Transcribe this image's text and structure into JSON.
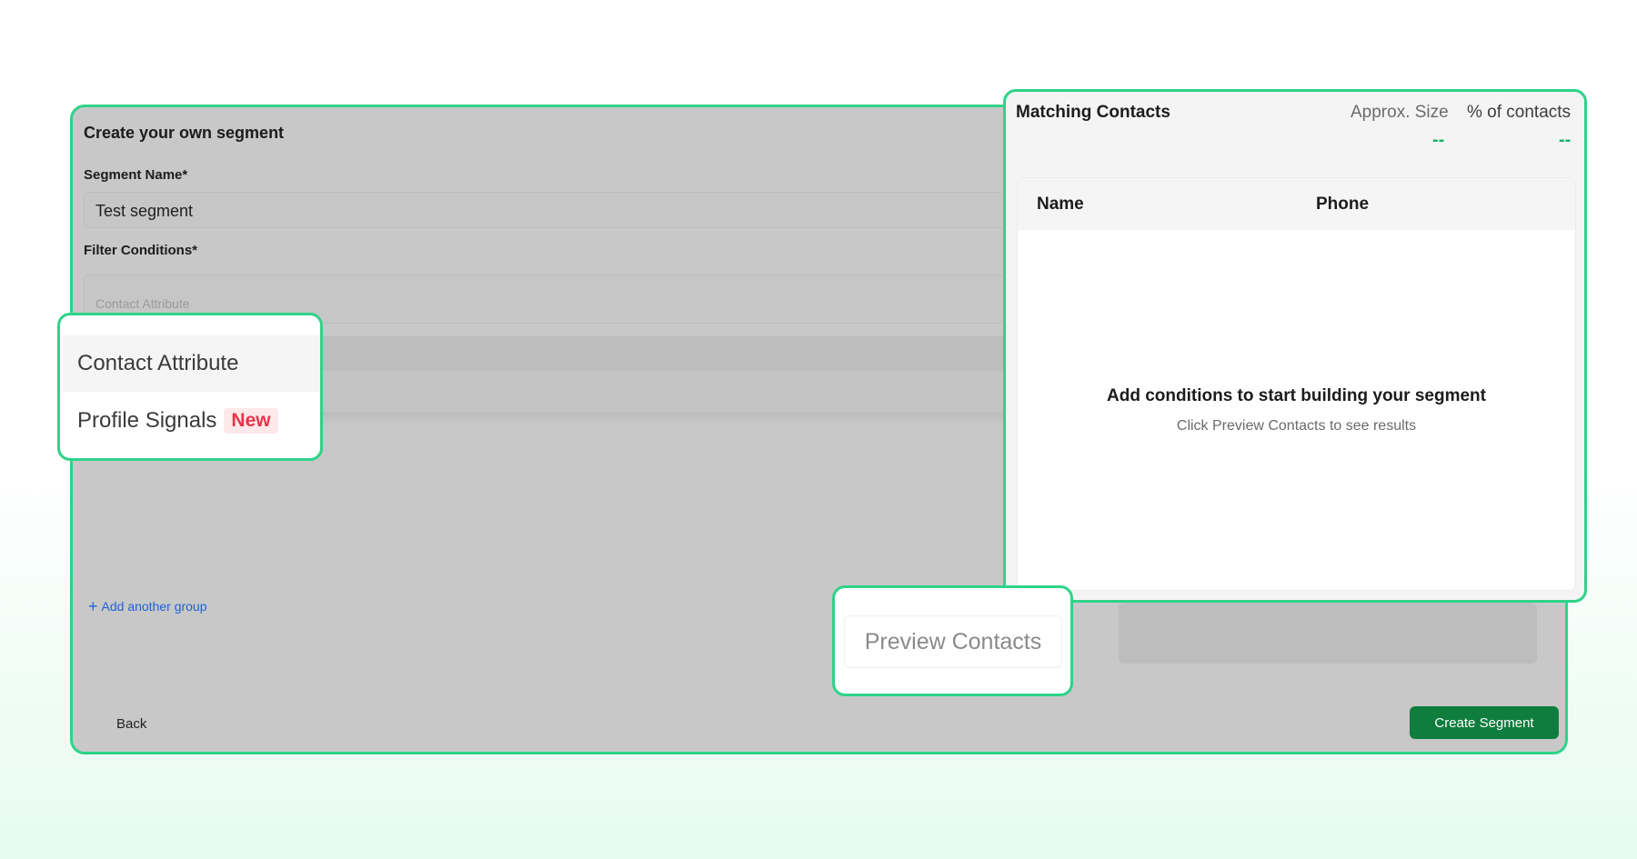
{
  "form": {
    "title": "Create your own segment",
    "segment_name_label": "Segment Name*",
    "segment_name_value": "Test segment",
    "filter_label": "Filter Conditions*",
    "filter_placeholder": "Contact Attribute",
    "add_group_label": "Add another group",
    "back_label": "Back",
    "create_label": "Create Segment"
  },
  "attribute_dropdown": {
    "options": [
      {
        "label": "Contact Attribute"
      },
      {
        "label": "Profile Signals",
        "badge": "New"
      }
    ]
  },
  "matching": {
    "title": "Matching Contacts",
    "approx_label": "Approx. Size",
    "percent_label": "% of contacts",
    "approx_value": "--",
    "percent_value": "--",
    "columns": [
      "Name",
      "Phone"
    ],
    "empty_title": "Add conditions to start building your segment",
    "empty_subtitle": "Click Preview Contacts to see results"
  },
  "preview": {
    "label": "Preview Contacts"
  },
  "colors": {
    "highlight_border": "#2ed389",
    "primary_button": "#0f7d3d",
    "link": "#1f62d6",
    "badge_text": "#e8344a",
    "badge_bg": "#fde8ea",
    "stat_value": "#17b169"
  },
  "icons": {
    "add_group": "plus-icon"
  }
}
